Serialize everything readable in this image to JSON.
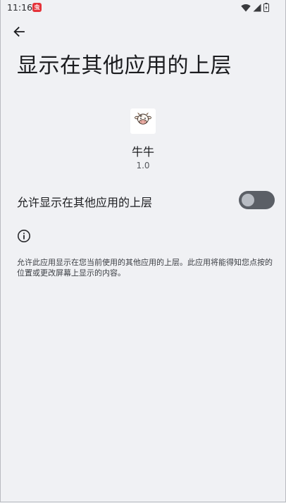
{
  "status_bar": {
    "time": "11:16",
    "notification_glyph": "虫",
    "icons": [
      "wifi-icon",
      "signal-icon",
      "battery-icon"
    ]
  },
  "header": {
    "back_icon": "arrow-back-icon",
    "title": "显示在其他应用的上层"
  },
  "app": {
    "icon": "cow-face-icon",
    "name": "牛牛",
    "version": "1.0"
  },
  "setting": {
    "label": "允许显示在其他应用的上层",
    "enabled": false
  },
  "info": {
    "icon": "info-icon",
    "description": "允许此应用显示在您当前使用的其他应用的上层。此应用将能得知您点按的位置或更改屏幕上显示的内容。"
  },
  "colors": {
    "background": "#f0f1f4",
    "text_primary": "#1b1c1f",
    "toggle_track_off": "#5b5f66",
    "toggle_thumb_off": "#b8bcc3",
    "notification_badge": "#e5333a"
  }
}
